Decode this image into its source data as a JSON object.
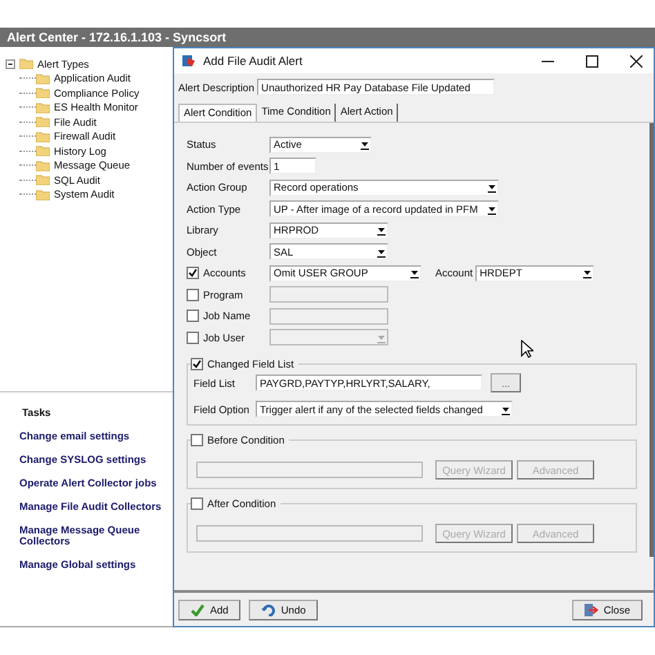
{
  "app": {
    "title": "Alert Center - 172.16.1.103 - Syncsort"
  },
  "tree": {
    "label": "Alert Types",
    "expanded": true,
    "children": [
      {
        "label": "Application Audit"
      },
      {
        "label": "Compliance Policy"
      },
      {
        "label": "ES Health Monitor"
      },
      {
        "label": "File Audit"
      },
      {
        "label": "Firewall Audit"
      },
      {
        "label": "History Log"
      },
      {
        "label": "Message Queue"
      },
      {
        "label": "SQL Audit"
      },
      {
        "label": "System Audit"
      }
    ]
  },
  "tasks": {
    "title": "Tasks",
    "links": [
      "Change email settings",
      "Change SYSLOG settings",
      "Operate Alert Collector jobs",
      "Manage File Audit Collectors",
      "Manage Message Queue Collectors",
      "Manage Global settings"
    ]
  },
  "dialog": {
    "title": "Add File Audit Alert",
    "description": {
      "label": "Alert Description",
      "value": "Unauthorized HR Pay Database File Updated"
    },
    "tabs": [
      {
        "label": "Alert Condition",
        "selected": true
      },
      {
        "label": "Time Condition",
        "selected": false
      },
      {
        "label": "Alert Action",
        "selected": false
      }
    ],
    "fields": [
      {
        "kind": "select",
        "label": "Status",
        "value": "Active"
      },
      {
        "kind": "text",
        "label": "Number of events",
        "value": "1"
      },
      {
        "kind": "select",
        "label": "Action Group",
        "value": "Record operations"
      },
      {
        "kind": "select",
        "label": "Action Type",
        "value": "UP - After image of a record updated in PFM"
      },
      {
        "kind": "select",
        "label": "Library",
        "value": "HRPROD"
      },
      {
        "kind": "select",
        "label": "Object",
        "value": "SAL"
      },
      {
        "kind": "check-select",
        "label": "Accounts",
        "checked": true,
        "disabled": false,
        "value": "Omit USER GROUP",
        "extra_label": "Account",
        "extra_value": "HRDEPT"
      },
      {
        "kind": "check-text",
        "label": "Program",
        "checked": false,
        "disabled": true
      },
      {
        "kind": "check-text",
        "label": "Job Name",
        "checked": false,
        "disabled": true
      },
      {
        "kind": "check-select",
        "label": "Job User",
        "checked": false,
        "disabled": true
      }
    ],
    "changed_field_list": {
      "label": "Changed Field List",
      "checked": true,
      "field_list": {
        "label": "Field List",
        "value": "PAYGRD,PAYTYP,HRLYRT,SALARY,",
        "button": "..."
      },
      "field_option": {
        "label": "Field Option",
        "value": "Trigger alert if any of the selected fields changed"
      }
    },
    "conditions": [
      {
        "label": "Before Condition",
        "checked": false,
        "buttons": [
          "Query Wizard",
          "Advanced"
        ],
        "disabled": true
      },
      {
        "label": "After Condition",
        "checked": false,
        "buttons": [
          "Query Wizard",
          "Advanced"
        ],
        "disabled": true
      }
    ],
    "buttons": [
      {
        "kind": "add",
        "label": "Add"
      },
      {
        "kind": "undo",
        "label": "Undo"
      },
      {
        "kind": "close",
        "label": "Close"
      }
    ]
  }
}
